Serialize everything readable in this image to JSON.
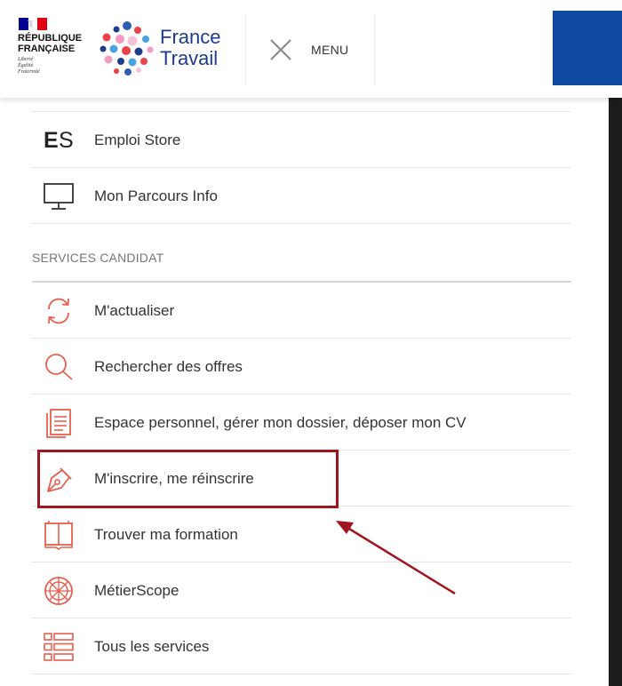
{
  "header": {
    "republique": "RÉPUBLIQUE\nFRANÇAISE",
    "motto": "Liberté\nÉgalité\nFraternité",
    "brand_name": "France\nTravail",
    "menu_label": "MENU",
    "colors": {
      "brand_blue": "#1e3b8c",
      "header_block_blue": "#0e4aa0"
    }
  },
  "menu": {
    "general_items": [
      {
        "icon": "es-logo-icon",
        "label": "Emploi Store"
      },
      {
        "icon": "monitor-icon",
        "label": "Mon Parcours Info"
      }
    ],
    "section_title": "SERVICES CANDIDAT",
    "candidate_items": [
      {
        "icon": "refresh-icon",
        "label": "M'actualiser"
      },
      {
        "icon": "search-icon",
        "label": "Rechercher des offres"
      },
      {
        "icon": "document-icon",
        "label": "Espace personnel, gérer mon dossier, déposer mon CV"
      },
      {
        "icon": "pen-nib-icon",
        "label": "M'inscrire, me réinscrire"
      },
      {
        "icon": "book-icon",
        "label": "Trouver ma formation"
      },
      {
        "icon": "compass-globe-icon",
        "label": "MétierScope"
      },
      {
        "icon": "list-icon",
        "label": "Tous les services"
      }
    ],
    "colors": {
      "icon_accent": "#e4604f",
      "text": "#333333",
      "annotation": "#a0161f"
    }
  }
}
